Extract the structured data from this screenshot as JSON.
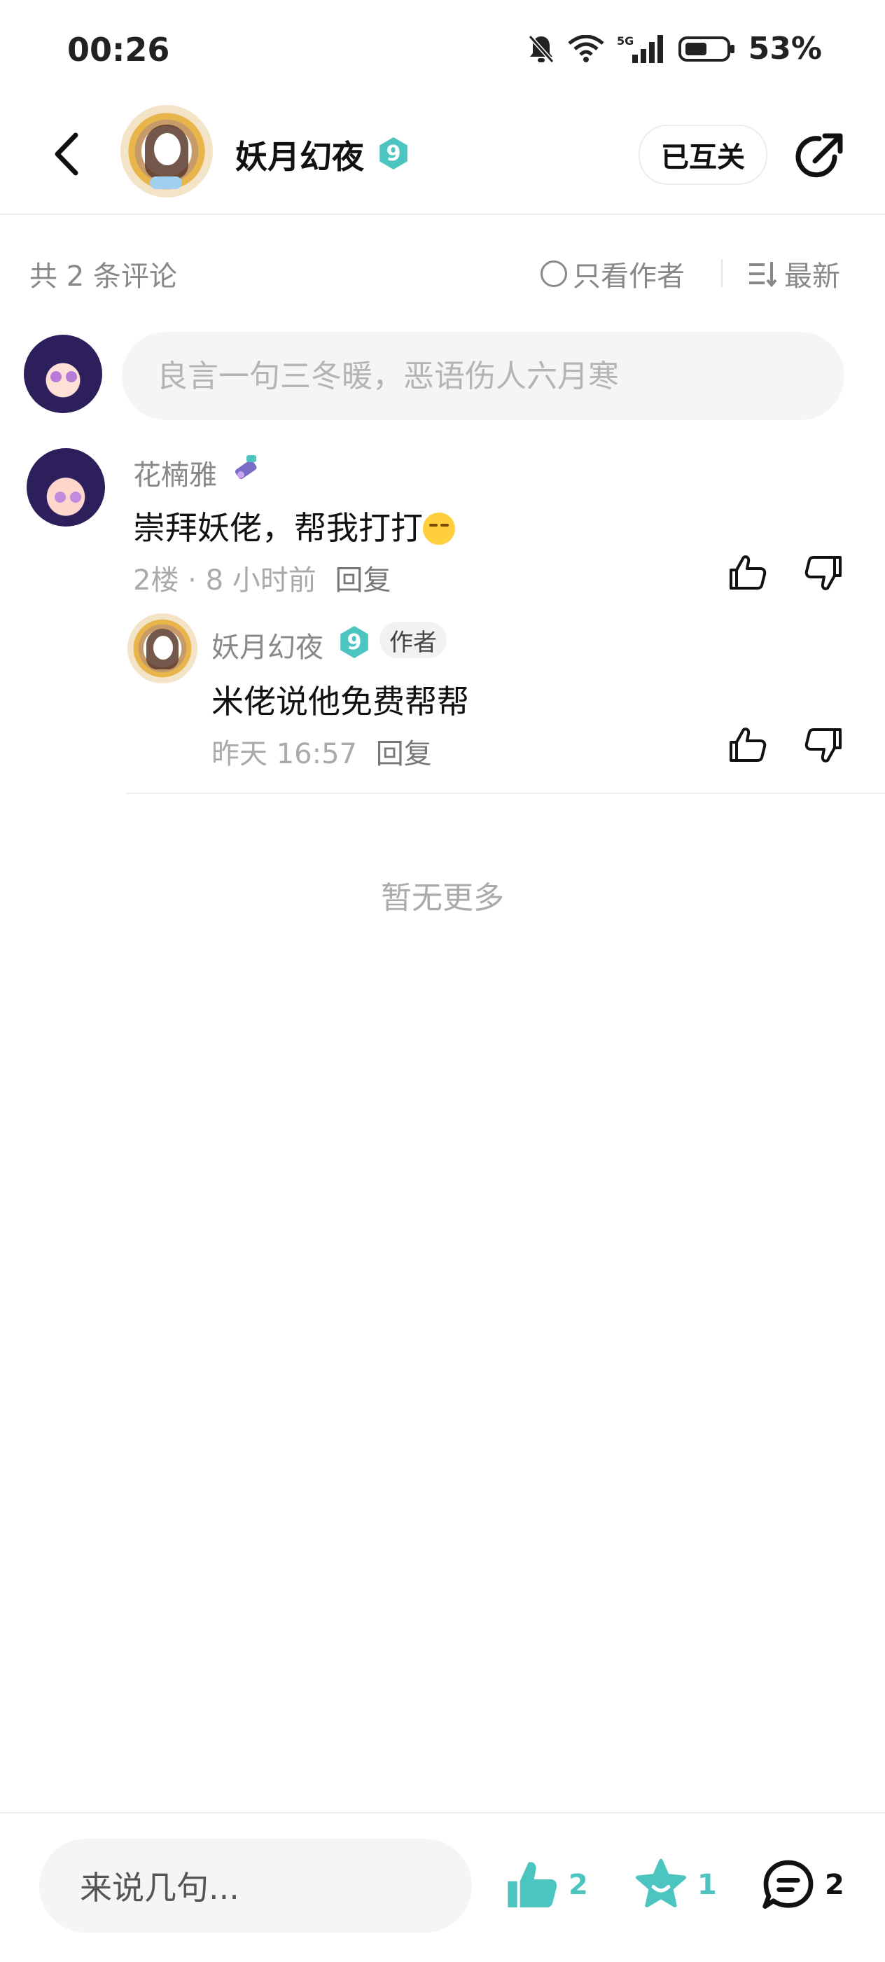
{
  "status_bar": {
    "time": "00:26",
    "battery": "53%",
    "network": "5G"
  },
  "header": {
    "name": "妖月幻夜",
    "level": "9",
    "follow_label": "已互关"
  },
  "comments_bar": {
    "count_text": "共 2 条评论",
    "author_only_label": "只看作者",
    "sort_label": "最新"
  },
  "input": {
    "placeholder": "良言一句三冬暖，恶语伤人六月寒"
  },
  "comments": [
    {
      "user": "花楠雅",
      "text": "崇拜妖佬，帮我打打",
      "floor": "2楼",
      "time": "8 小时前",
      "reply_label": "回复",
      "replies": [
        {
          "user": "妖月幻夜",
          "level": "9",
          "tag": "作者",
          "text": "米佬说他免费帮帮",
          "time": "昨天 16:57",
          "reply_label": "回复"
        }
      ]
    }
  ],
  "footer_note": "暂无更多",
  "bottom_bar": {
    "placeholder": "来说几句...",
    "like_count": "2",
    "star_count": "1",
    "comment_count": "2"
  },
  "colors": {
    "accent": "#4cc5c0",
    "muted": "#888888",
    "input_bg": "#f4f5f7"
  }
}
